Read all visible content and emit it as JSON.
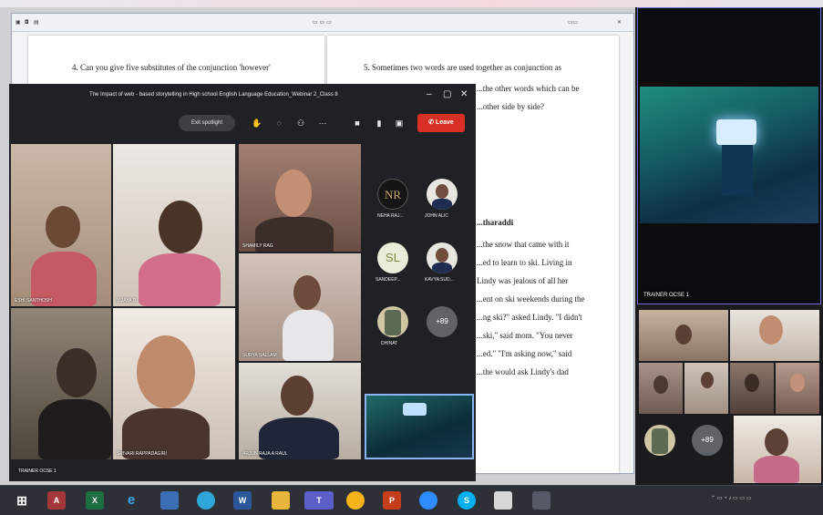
{
  "document": {
    "left_question": "4. Can you give five substitutes of the conjunction 'however'",
    "right_question": "5. Sometimes two words are used together as conjunction as",
    "right_lines": [
      "...the other words which can be",
      "...other side by side?"
    ],
    "passage_heading": "...tharaddi",
    "passage_lines": [
      "...the snow that came with it",
      "...ed to learn to ski. Living in",
      "Lindy was jealous of all her",
      "...ent on ski weekends during the",
      "...ng ski?\" asked Lindy. \"I didn't",
      "...ski,\" said mom. \"You never",
      "...ed.\" \"I'm asking now,\" said",
      "...the would ask Lindy's dad"
    ]
  },
  "meet": {
    "window_title": "The Impact of web - based storytelling in High school English Language Education_Webinar 2_Class 8",
    "spotlight_label": "Exit spotlight",
    "leave_label": "Leave",
    "tiles": [
      {
        "name": "ESHI SANTHOSH"
      },
      {
        "name": "VIJAYA D"
      },
      {
        "name": "SHAMILY RAG"
      },
      {
        "name": "SURYA SALLAM"
      },
      {
        "name": "SRIVARI RAPPADAGIRI"
      },
      {
        "name": "ARJUN RAJA A RAUL"
      },
      {
        "name": "TRAINER OCSE 1"
      }
    ],
    "side_tiles": [
      {
        "initials": "NR",
        "name": "NEHA RAJ..."
      },
      {
        "name": "JOHN ALIC"
      },
      {
        "initials": "SL",
        "name": "SANDEEP..."
      },
      {
        "name": "KAVYA SUD..."
      },
      {
        "name": "DHINAT"
      },
      {
        "more": "+89"
      }
    ]
  },
  "right_panel": {
    "main_name": "TRAINER OCSE 1",
    "more": "+89"
  },
  "taskbar": {
    "apps": [
      "Access",
      "Excel",
      "Edge",
      "Explorer",
      "Telegram",
      "Word",
      "Files",
      "Teams",
      "Chrome",
      "PowerPoint",
      "Zoom",
      "Skype",
      "Paint",
      "Tool"
    ],
    "app_letters": [
      "A",
      "X",
      "e",
      "",
      "",
      "W",
      "",
      "T",
      "",
      "P",
      "",
      "S",
      "",
      ""
    ],
    "colors": {
      "access": "#a4373a",
      "excel": "#1d6f42",
      "edge": "#1e90d6",
      "word": "#2b579a",
      "teams": "#5b5fc7",
      "powerpoint": "#c43e1c",
      "zoom": "#2d8cff",
      "skype": "#00aff0"
    }
  }
}
